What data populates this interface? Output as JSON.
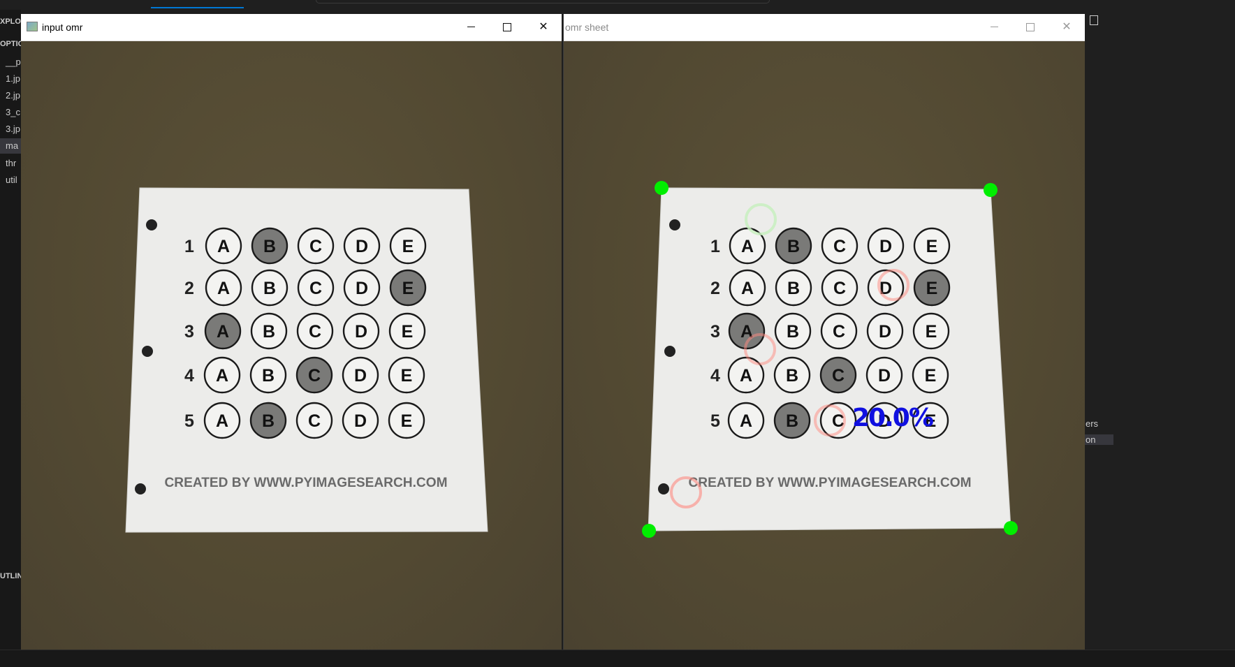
{
  "editor": {
    "explorer_header": "XPLO",
    "section_header": "OPTIC",
    "files": [
      "__p",
      "1.jp",
      "2.jp",
      "3_c",
      "3.jp",
      "ma",
      "thr",
      "util"
    ],
    "selected_file_index": 5,
    "outline_header": "UTLINE",
    "right_fragments": [
      "ers",
      "on"
    ]
  },
  "windows": {
    "input": {
      "title": "input omr",
      "icon": "opencv-window-icon",
      "controls": {
        "minimize": "minimize-icon",
        "maximize": "maximize-icon",
        "close": "close-icon"
      }
    },
    "output": {
      "title": "omr sheet",
      "icon": "opencv-window-icon",
      "controls": {
        "minimize": "minimize-icon",
        "maximize": "maximize-icon",
        "close": "close-icon"
      }
    }
  },
  "sheet": {
    "choices": [
      "A",
      "B",
      "C",
      "D",
      "E"
    ],
    "questions": [
      {
        "number": "1",
        "marked": "B"
      },
      {
        "number": "2",
        "marked": "E"
      },
      {
        "number": "3",
        "marked": "A"
      },
      {
        "number": "4",
        "marked": "C"
      },
      {
        "number": "5",
        "marked": "B"
      }
    ],
    "footer": "CREATED BY WWW.PYIMAGESEARCH.COM"
  },
  "overlay": {
    "score": "20.0%",
    "score_color": "#1010e0",
    "corner_color": "#00ee00",
    "correct_ring_color": "#c8f0c0",
    "wrong_ring_color": "#ff8a80"
  }
}
